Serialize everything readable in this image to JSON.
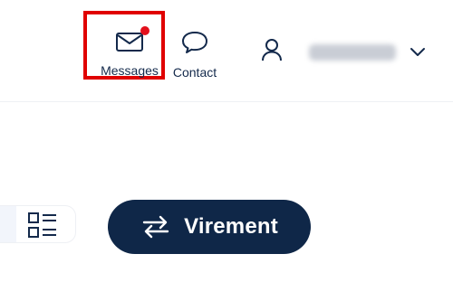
{
  "header": {
    "messages": {
      "label": "Messages",
      "has_notification": true,
      "icon": "envelope-icon"
    },
    "contact": {
      "label": "Contact",
      "icon": "chat-bubble-icon"
    },
    "user": {
      "icon": "user-icon",
      "name_redacted": true,
      "dropdown_icon": "chevron-down-icon"
    }
  },
  "main": {
    "view_toggle": {
      "icon": "list-view-icon"
    },
    "virement_button": {
      "label": "Virement",
      "icon": "transfer-arrows-icon"
    }
  },
  "colors": {
    "primary": "#0f2748",
    "text": "#13294b",
    "highlight": "#e00000",
    "notification": "#e3101c"
  }
}
